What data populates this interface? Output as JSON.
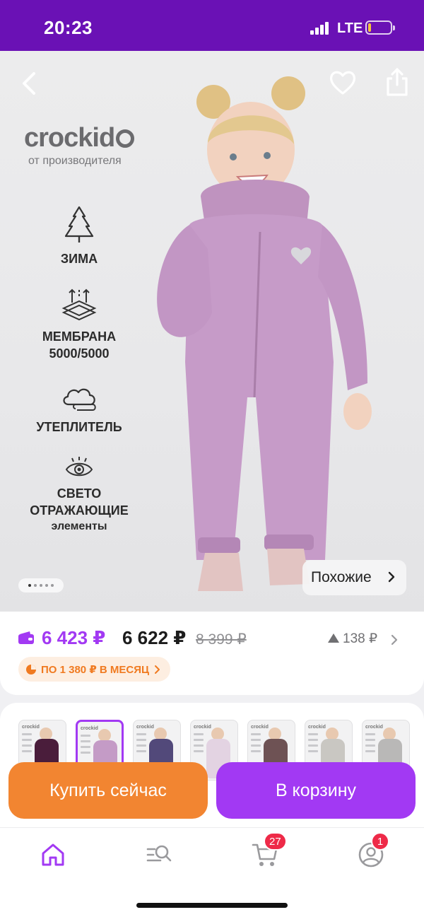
{
  "status_bar": {
    "time": "20:23",
    "network": "LTE",
    "battery_level": 0.12,
    "battery_color": "#f5c33b"
  },
  "hero": {
    "brand_name": "crockid",
    "brand_sub": "от производителя",
    "features": [
      {
        "label": "ЗИМА",
        "sub": "",
        "icon": "snow-tree-icon"
      },
      {
        "label": "МЕМБРАНА",
        "sub": "5000/5000",
        "icon": "membrane-icon"
      },
      {
        "label": "УТЕПЛИТЕЛЬ",
        "sub": "",
        "icon": "cloud-insulation-icon"
      },
      {
        "label": "СВЕТО",
        "sub": "ОТРАЖАЮЩИЕ",
        "sub2": "элементы",
        "icon": "eye-reflective-icon"
      }
    ],
    "gallery_dots": 5,
    "gallery_active": 0,
    "similar_label": "Похожие"
  },
  "price": {
    "wallet_price": "6 423 ₽",
    "regular_price": "6 622 ₽",
    "old_price": "8 399 ₽",
    "price_change": "138 ₽",
    "installment": "ПО 1 380 ₽ В МЕСЯЦ"
  },
  "variants": {
    "selected_index": 1,
    "items": [
      {
        "color": "#4a1d3b"
      },
      {
        "color": "#c49bc6"
      },
      {
        "color": "#52497a"
      },
      {
        "color": "#e3d3e2"
      },
      {
        "color": "#6e5254"
      },
      {
        "color": "#c9c7c2"
      },
      {
        "color": "#b9b8b7"
      }
    ]
  },
  "actions": {
    "buy_now": "Купить сейчас",
    "add_to_cart": "В корзину"
  },
  "tab_bar": {
    "accent": "#a239f3",
    "tabs": [
      {
        "name": "home",
        "icon": "home-icon",
        "active": true
      },
      {
        "name": "catalog",
        "icon": "catalog-search-icon"
      },
      {
        "name": "cart",
        "icon": "cart-icon",
        "badge": "27"
      },
      {
        "name": "profile",
        "icon": "profile-icon",
        "badge": "1"
      }
    ]
  },
  "colors": {
    "brand": "#6a11b5",
    "accent": "#a239f3",
    "orange": "#f28531"
  }
}
